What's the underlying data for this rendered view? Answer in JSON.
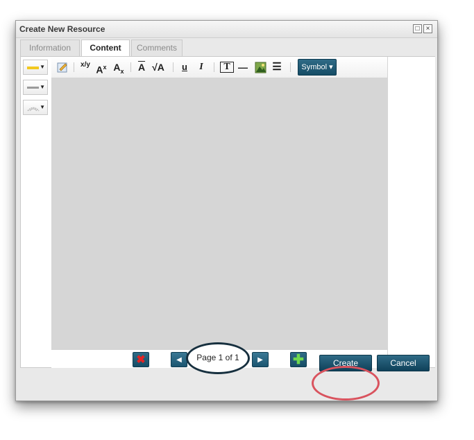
{
  "dialog": {
    "title": "Create New Resource",
    "window_buttons": {
      "restore": "□",
      "close": "×"
    }
  },
  "tabs": [
    {
      "label": "Information",
      "active": false
    },
    {
      "label": "Content",
      "active": true
    },
    {
      "label": "Comments",
      "active": false
    }
  ],
  "left_tools": [
    {
      "name": "highlight-color-dropdown",
      "swatch_color": "#f2c81e"
    },
    {
      "name": "line-color-dropdown",
      "swatch_color": "#9a9a9a"
    },
    {
      "name": "line-style-dropdown",
      "swatch_color": "#b5b5b5"
    }
  ],
  "toolbar": {
    "fraction": "x/y",
    "superscript": "A",
    "superscript_mark": "x",
    "subscript": "A",
    "subscript_mark": "x",
    "overline": "A",
    "sqrt": "√A",
    "underline": "u",
    "italic": "I",
    "textbox": "T",
    "hline": "—",
    "list": "☰",
    "symbol_label": "Symbol",
    "symbol_caret": "▾"
  },
  "pager": {
    "delete": "✖",
    "prev": "◀",
    "next": "▶",
    "add": "✚",
    "page_label": "Page 1 of 1"
  },
  "footer": {
    "create_label": "Create",
    "cancel_label": "Cancel"
  },
  "colors": {
    "accent": "#1b5570",
    "annotation_red": "#d9535e",
    "annotation_dark": "#17303f"
  }
}
